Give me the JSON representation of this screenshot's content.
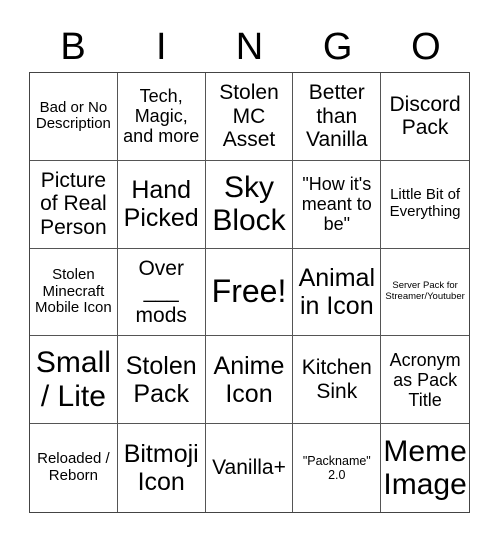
{
  "header": {
    "letters": [
      "B",
      "I",
      "N",
      "G",
      "O"
    ]
  },
  "board": {
    "rows": [
      [
        "Bad or No Description",
        "Tech, Magic, and more",
        "Stolen MC Asset",
        "Better than Vanilla",
        "Discord Pack"
      ],
      [
        "Picture of Real Person",
        "Hand Picked",
        "Sky Block",
        "\"How it's meant to be\"",
        "Little Bit of Everything"
      ],
      [
        "Stolen Minecraft Mobile Icon",
        "Over ___ mods",
        "Free!",
        "Animal in Icon",
        "Server Pack for Streamer/Youtuber"
      ],
      [
        "Small / Lite",
        "Stolen Pack",
        "Anime Icon",
        "Kitchen Sink",
        "Acronym as Pack Title"
      ],
      [
        "Reloaded / Reborn",
        "Bitmoji Icon",
        "Vanilla+",
        "\"Packname\" 2.0",
        "Meme Image"
      ]
    ]
  },
  "colors": {
    "background": "#ffffff",
    "text": "#000000",
    "grid_lines": "#555555"
  }
}
